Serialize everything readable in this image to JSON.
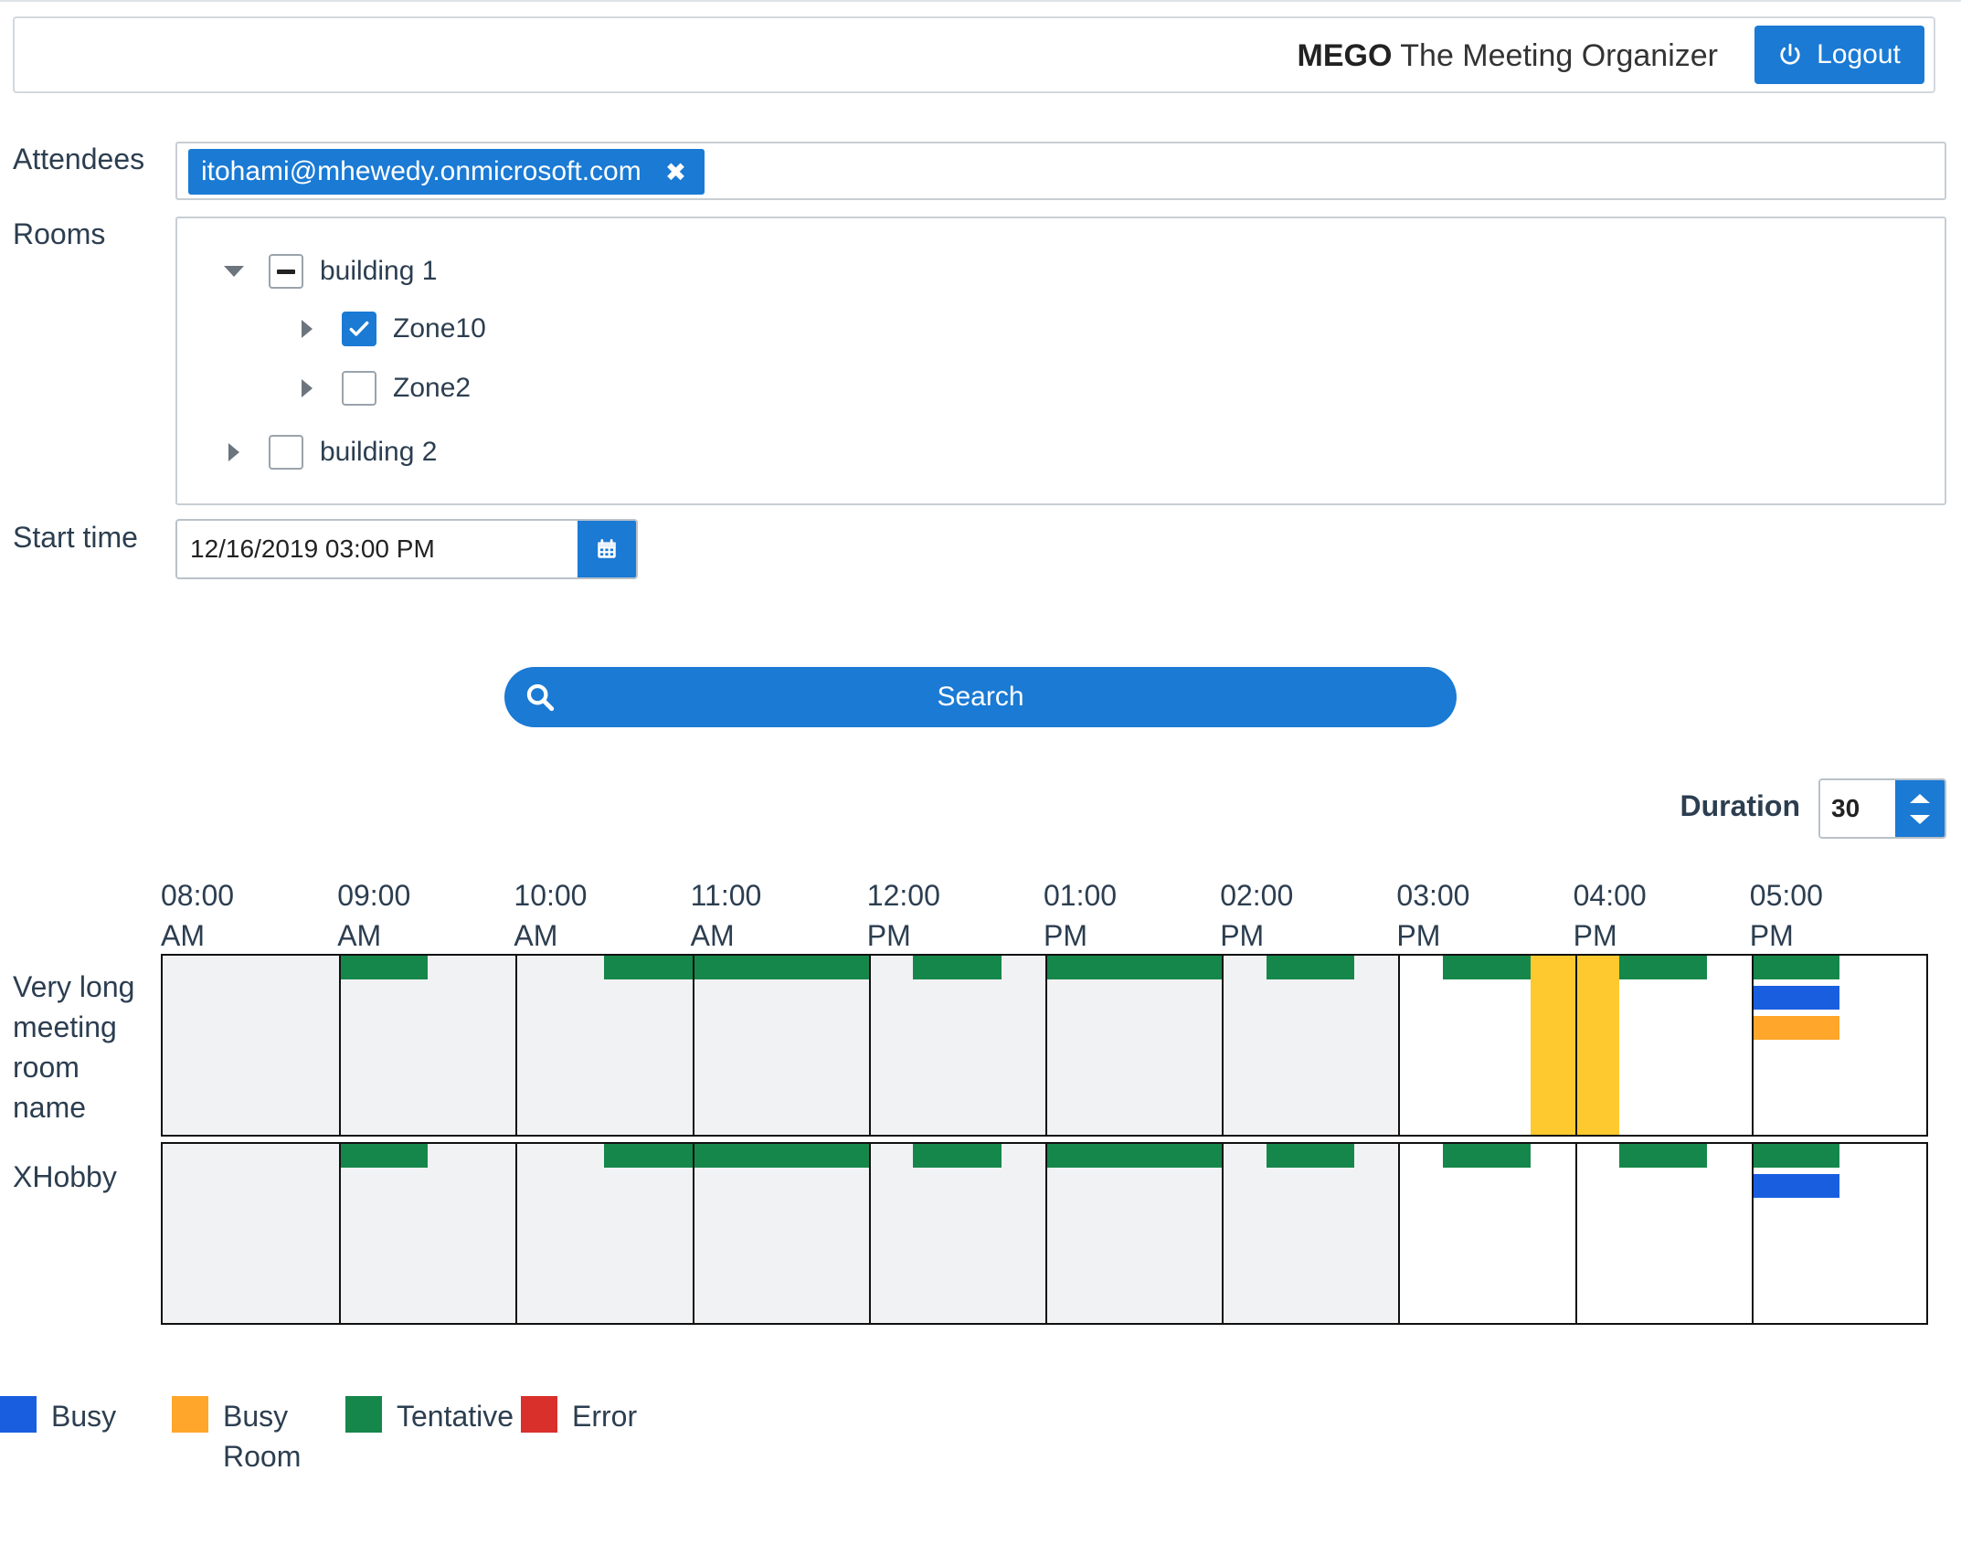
{
  "header": {
    "brand_bold": "MEGO",
    "brand_rest": "The Meeting Organizer",
    "logout_label": "Logout"
  },
  "form": {
    "attendees_label": "Attendees",
    "attendees": [
      "itohami@mhewedy.onmicrosoft.com"
    ],
    "rooms_label": "Rooms",
    "tree": [
      {
        "label": "building 1",
        "expanded": true,
        "state": "partial"
      },
      {
        "label": "Zone10",
        "expanded": false,
        "state": "checked"
      },
      {
        "label": "Zone2",
        "expanded": false,
        "state": "unchecked"
      },
      {
        "label": "building 2",
        "expanded": false,
        "state": "unchecked"
      }
    ],
    "start_time_label": "Start time",
    "start_time_value": "12/16/2019 03:00 PM",
    "search_label": "Search",
    "duration_label": "Duration",
    "duration_value": "30"
  },
  "schedule": {
    "hours": [
      {
        "time": "08:00",
        "period": "AM"
      },
      {
        "time": "09:00",
        "period": "AM"
      },
      {
        "time": "10:00",
        "period": "AM"
      },
      {
        "time": "11:00",
        "period": "AM"
      },
      {
        "time": "12:00",
        "period": "PM"
      },
      {
        "time": "01:00",
        "period": "PM"
      },
      {
        "time": "02:00",
        "period": "PM"
      },
      {
        "time": "03:00",
        "period": "PM"
      },
      {
        "time": "04:00",
        "period": "PM"
      },
      {
        "time": "05:00",
        "period": "PM"
      }
    ],
    "rooms": [
      {
        "name": "Very long meeting room name",
        "events": [
          {
            "status": "tentative",
            "start": "09:00",
            "end": "09:30"
          },
          {
            "status": "tentative",
            "start": "10:30",
            "end": "12:00"
          },
          {
            "status": "tentative",
            "start": "12:15",
            "end": "12:45"
          },
          {
            "status": "tentative",
            "start": "13:00",
            "end": "14:00"
          },
          {
            "status": "tentative",
            "start": "14:15",
            "end": "14:45"
          },
          {
            "status": "tentative",
            "start": "15:15",
            "end": "15:45"
          },
          {
            "status": "selected",
            "start": "15:45",
            "end": "16:15"
          },
          {
            "status": "tentative",
            "start": "16:15",
            "end": "16:45"
          },
          {
            "status": "tentative",
            "start": "17:00",
            "end": "17:30"
          },
          {
            "status": "busy",
            "start": "17:00",
            "end": "17:30"
          },
          {
            "status": "busy_room",
            "start": "17:00",
            "end": "17:30"
          }
        ]
      },
      {
        "name": "XHobby",
        "events": [
          {
            "status": "tentative",
            "start": "09:00",
            "end": "09:30"
          },
          {
            "status": "tentative",
            "start": "10:30",
            "end": "12:00"
          },
          {
            "status": "tentative",
            "start": "12:15",
            "end": "12:45"
          },
          {
            "status": "tentative",
            "start": "13:00",
            "end": "14:00"
          },
          {
            "status": "tentative",
            "start": "14:15",
            "end": "14:45"
          },
          {
            "status": "tentative",
            "start": "15:15",
            "end": "15:45"
          },
          {
            "status": "tentative",
            "start": "16:15",
            "end": "16:45"
          },
          {
            "status": "tentative",
            "start": "17:00",
            "end": "17:30"
          },
          {
            "status": "busy",
            "start": "17:00",
            "end": "17:30"
          }
        ]
      }
    ],
    "past_until": "15:00"
  },
  "legend": [
    {
      "label": "Busy",
      "color": "#1a5ee0"
    },
    {
      "label": "Busy Room",
      "color": "#ffa62b"
    },
    {
      "label": "Tentative",
      "color": "#16874a"
    },
    {
      "label": "Error",
      "color": "#d9302c"
    }
  ],
  "colors": {
    "primary": "#1a7ad4",
    "tentative": "#16874a",
    "busy": "#1a5ee0",
    "busy_room": "#ffa62b",
    "selected": "#fdc92f",
    "past_cell": "#f1f2f4"
  }
}
